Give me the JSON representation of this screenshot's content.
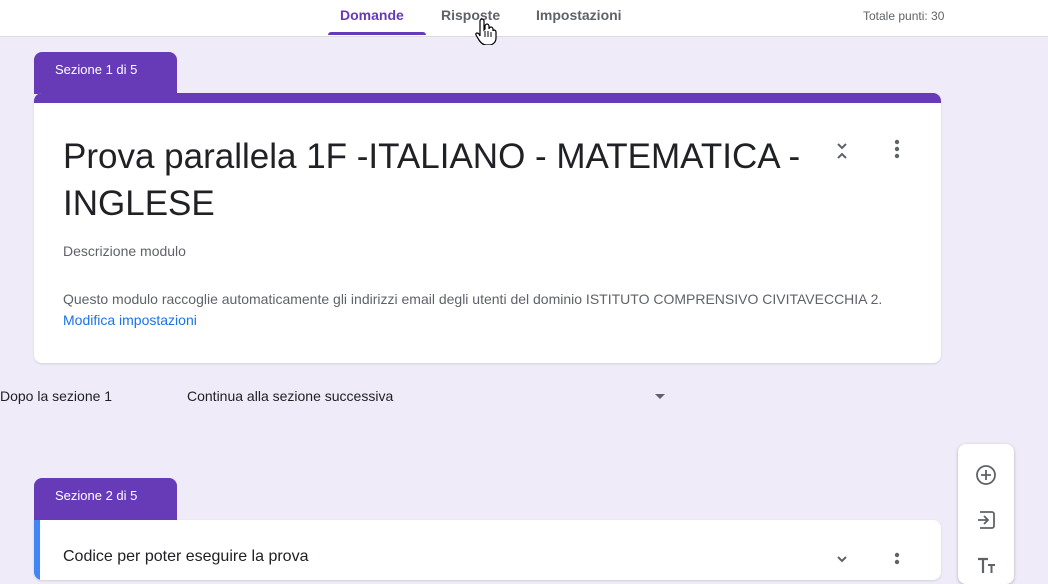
{
  "tabs": [
    {
      "label": "Domande",
      "active": true
    },
    {
      "label": "Risposte",
      "active": false
    },
    {
      "label": "Impostazioni",
      "active": false
    }
  ],
  "total_points": "Totale punti: 30",
  "section1": {
    "tab_label": "Sezione 1 di 5",
    "title": "Prova parallela 1F -ITALIANO - MATEMATICA - INGLESE",
    "description": "Descrizione modulo",
    "email_note": "Questo modulo raccoglie automaticamente gli indirizzi email degli utenti del dominio ISTITUTO COMPRENSIVO CIVITAVECCHIA 2.",
    "email_link": "Modifica impostazioni"
  },
  "after_section": {
    "label": "Dopo la sezione 1",
    "selected": "Continua alla sezione successiva"
  },
  "section2": {
    "tab_label": "Sezione 2 di 5",
    "title": "Codice per poter eseguire la prova"
  },
  "toolbar": [
    "add-question-icon",
    "import-questions-icon",
    "add-title-icon"
  ],
  "colors": {
    "accent": "#673ab7",
    "background": "#f0ebf8",
    "link": "#1a73e8",
    "active_card_bar": "#4285f4"
  }
}
